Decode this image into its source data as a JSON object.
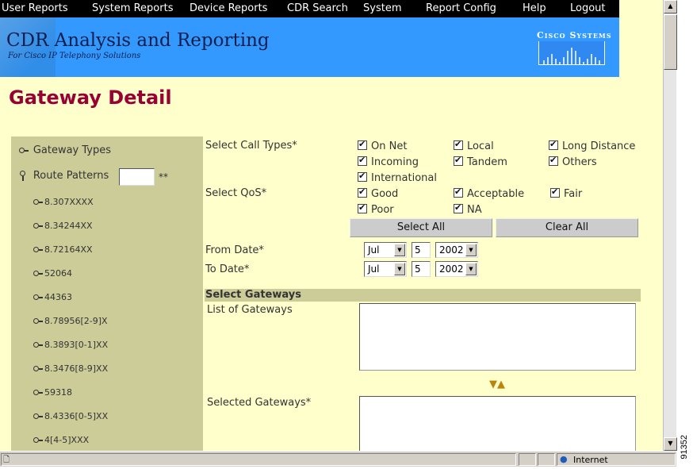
{
  "nav": {
    "items": [
      "User Reports",
      "System Reports",
      "Device Reports",
      "CDR Search",
      "System",
      "Report Config",
      "Help",
      "Logout"
    ]
  },
  "banner": {
    "title": "CDR Analysis and Reporting",
    "subtitle": "For Cisco IP Telephony Solutions",
    "logo_text": "Cisco Systems"
  },
  "page_title": "Gateway Detail",
  "tree": {
    "gateway_types": "Gateway Types",
    "route_patterns": "Route Patterns",
    "route_input_value": "",
    "required_marker": "**",
    "patterns": [
      "8.307XXXX",
      "8.34244XX",
      "8.72164XX",
      "52064",
      "44363",
      "8.78956[2-9]X",
      "8.3893[0-1]XX",
      "8.3476[8-9]XX",
      "59318",
      "8.4336[0-5]XX",
      "4[4-5]XXX"
    ]
  },
  "form": {
    "call_types_label": "Select Call Types*",
    "call_types": [
      {
        "label": "On Net",
        "checked": true
      },
      {
        "label": "Local",
        "checked": true
      },
      {
        "label": "Long Distance",
        "checked": true
      },
      {
        "label": "Incoming",
        "checked": true
      },
      {
        "label": "Tandem",
        "checked": true
      },
      {
        "label": "Others",
        "checked": true
      },
      {
        "label": "International",
        "checked": true
      }
    ],
    "qos_label": "Select QoS*",
    "qos": [
      {
        "label": "Good",
        "checked": true
      },
      {
        "label": "Acceptable",
        "checked": true
      },
      {
        "label": "Fair",
        "checked": true
      },
      {
        "label": "Poor",
        "checked": true
      },
      {
        "label": "NA",
        "checked": true
      }
    ],
    "select_all": "Select All",
    "clear_all": "Clear All",
    "from_date_label": "From Date*",
    "to_date_label": "To Date*",
    "from_date": {
      "month": "Jul",
      "day": "5",
      "year": "2002"
    },
    "to_date": {
      "month": "Jul",
      "day": "5",
      "year": "2002"
    },
    "section_title": "Select Gateways",
    "list_label": "List of Gateways",
    "selected_label": "Selected Gateways*",
    "move_arrows": "▼▲"
  },
  "status": {
    "zone": "Internet"
  },
  "figure_number": "91352",
  "colors": {
    "page_bg": "#ffffcc",
    "nav_bg": "#000000",
    "banner_bg": "#3399ff",
    "title": "#990033",
    "panel": "#cccc99"
  }
}
